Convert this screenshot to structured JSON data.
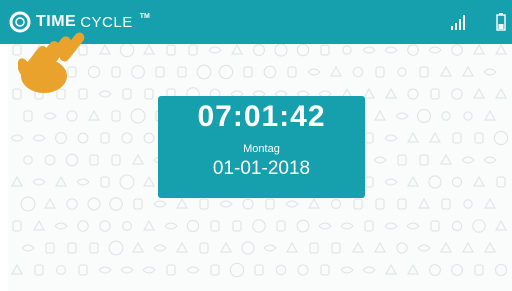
{
  "app": {
    "logo_bold": "TIME",
    "logo_light": "CYCLE",
    "logo_mark": "TM"
  },
  "status_bar": {
    "signal_icon": "signal-icon",
    "battery_icon": "battery-icon"
  },
  "clock": {
    "time": "07:01:42",
    "day": "Montag",
    "date": "01-01-2018"
  },
  "overlay": {
    "icon": "pointing-hand-icon"
  },
  "colors": {
    "accent": "#16a0ad",
    "background": "#ffffff",
    "hand": "#e9a32c",
    "pattern": "#dfe6e7"
  }
}
